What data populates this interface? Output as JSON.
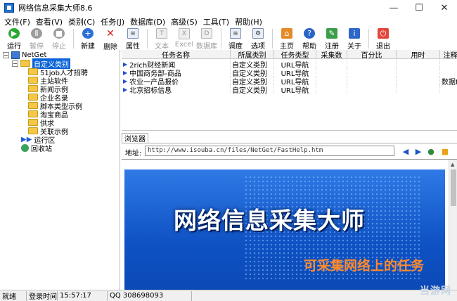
{
  "window": {
    "title": "网络信息采集大师8.6",
    "minimize": "—",
    "maximize": "☐",
    "close": "✕"
  },
  "menu": [
    "文件(F)",
    "查看(V)",
    "类别(C)",
    "任务(J)",
    "数据库(D)",
    "高级(S)",
    "工具(T)",
    "帮助(H)"
  ],
  "toolbar": [
    {
      "label": "运行",
      "icon": "▶",
      "style": "green",
      "enabled": true
    },
    {
      "label": "暂停",
      "icon": "Ⅱ",
      "style": "gray",
      "enabled": false
    },
    {
      "label": "停止",
      "icon": "■",
      "style": "gray",
      "enabled": false
    },
    {
      "label": "新建",
      "icon": "+",
      "style": "blue",
      "enabled": true
    },
    {
      "label": "删除",
      "icon": "✕",
      "style": "red",
      "enabled": true
    },
    {
      "label": "属性",
      "icon": "≡",
      "style": "doc",
      "enabled": true
    },
    {
      "label": "文本",
      "icon": "T",
      "style": "docd",
      "enabled": false
    },
    {
      "label": "Excel",
      "icon": "X",
      "style": "docd",
      "enabled": false
    },
    {
      "label": "数据库",
      "icon": "D",
      "style": "docd",
      "enabled": false
    },
    {
      "label": "调度",
      "icon": "≡",
      "style": "doc",
      "enabled": true
    },
    {
      "label": "选项",
      "icon": "⚙",
      "style": "doc",
      "enabled": true
    },
    {
      "label": "主页",
      "icon": "⌂",
      "style": "home",
      "enabled": true
    },
    {
      "label": "帮助",
      "icon": "?",
      "style": "help",
      "enabled": true
    },
    {
      "label": "注册",
      "icon": "✎",
      "style": "reg",
      "enabled": true
    },
    {
      "label": "关于",
      "icon": "i",
      "style": "about",
      "enabled": true
    },
    {
      "label": "退出",
      "icon": "⏻",
      "style": "exit",
      "enabled": true
    }
  ],
  "tree": {
    "root": "NetGet",
    "selected": "自定义类别",
    "children": [
      "51job人才招聘",
      "主站软件",
      "新闻示例",
      "企业名录",
      "脚本类型示例",
      "淘宝商品",
      "供求",
      "关联示例"
    ],
    "run_area": "运行区",
    "recycle": "回收站"
  },
  "grid": {
    "columns": [
      "任务名称",
      "所属类别",
      "任务类型",
      "采集数",
      "百分比",
      "用时",
      "注释"
    ],
    "rows": [
      {
        "name": "2rich财经新闻",
        "category": "自定义类别",
        "type": "URL导航",
        "count": "",
        "percent": "",
        "time": "",
        "note": ""
      },
      {
        "name": "中国商务部-商品",
        "category": "自定义类别",
        "type": "URL导航",
        "count": "",
        "percent": "",
        "time": "",
        "note": ""
      },
      {
        "name": "农业一产品报价",
        "category": "自定义类别",
        "type": "URL导航",
        "count": "",
        "percent": "",
        "time": "",
        "note": "数据t"
      },
      {
        "name": "北京招标信息",
        "category": "自定义类别",
        "type": "URL导航",
        "count": "",
        "percent": "",
        "time": "",
        "note": ""
      }
    ]
  },
  "browser": {
    "tab": "浏览器",
    "address_label": "地址:",
    "url": "http://www.isouba.cn/files/NetGet/FastHelp.htm",
    "banner_title": "网络信息采集大师",
    "banner_sub": "可采集网络上的任务"
  },
  "status": {
    "state": "就绪",
    "login_label": "登录时间",
    "time": "15:57:17",
    "qq": "QQ 308698093"
  },
  "watermark": "当游网",
  "colors": {
    "selection": "#0a64d8",
    "banner": "#1a5fd0",
    "banner_sub": "#ff8a2b"
  }
}
